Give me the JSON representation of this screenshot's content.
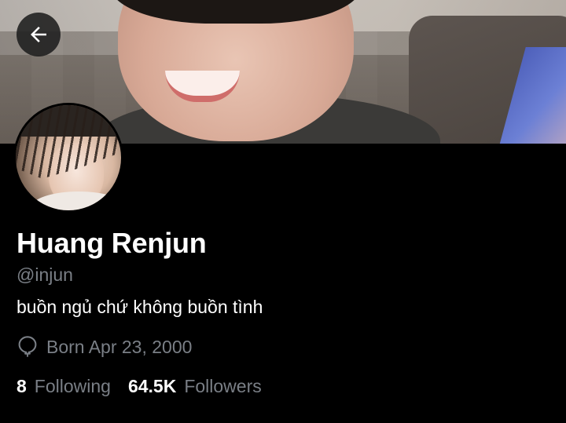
{
  "profile": {
    "name": "Huang Renjun",
    "handle": "@injun",
    "bio": "buồn ngủ chứ không buồn tình",
    "born": "Born Apr 23, 2000"
  },
  "stats": {
    "following_count": "8",
    "following_label": "Following",
    "followers_count": "64.5K",
    "followers_label": "Followers"
  },
  "icons": {
    "back": "arrow-left-icon",
    "born": "balloon-icon"
  },
  "colors": {
    "background": "#000000",
    "secondary_text": "#7a7f86",
    "primary_text": "#ffffff"
  }
}
